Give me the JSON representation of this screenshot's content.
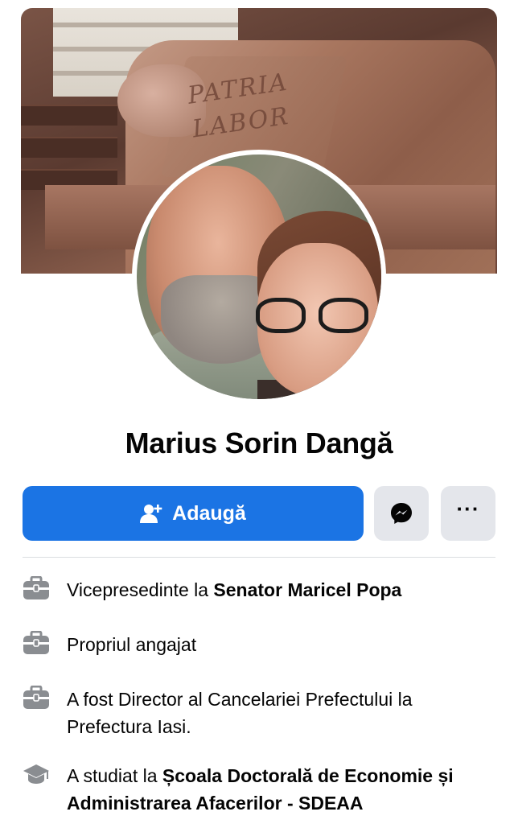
{
  "profile": {
    "name": "Marius Sorin Dangă"
  },
  "cover": {
    "engraving_line1": "PATRIA",
    "engraving_line2": "LABOR"
  },
  "actions": {
    "add_label": "Adaugă",
    "more_label": "···"
  },
  "details": [
    {
      "icon": "briefcase-icon",
      "prefix": "Vicepresedinte la ",
      "bold": "Senator Maricel Popa"
    },
    {
      "icon": "briefcase-icon",
      "prefix": "Propriul angajat",
      "bold": ""
    },
    {
      "icon": "briefcase-icon",
      "prefix": "A fost Director al Cancelariei Prefectului la Prefectura Iasi.",
      "bold": ""
    },
    {
      "icon": "graduation-cap-icon",
      "prefix": "A studiat la ",
      "bold": "Școala Doctorală de Economie și Administrarea Afacerilor - SDEAA"
    }
  ],
  "colors": {
    "primary": "#1b74e4",
    "secondary_button": "#e4e6eb",
    "icon_grey": "#8a8d91",
    "text": "#050505"
  }
}
